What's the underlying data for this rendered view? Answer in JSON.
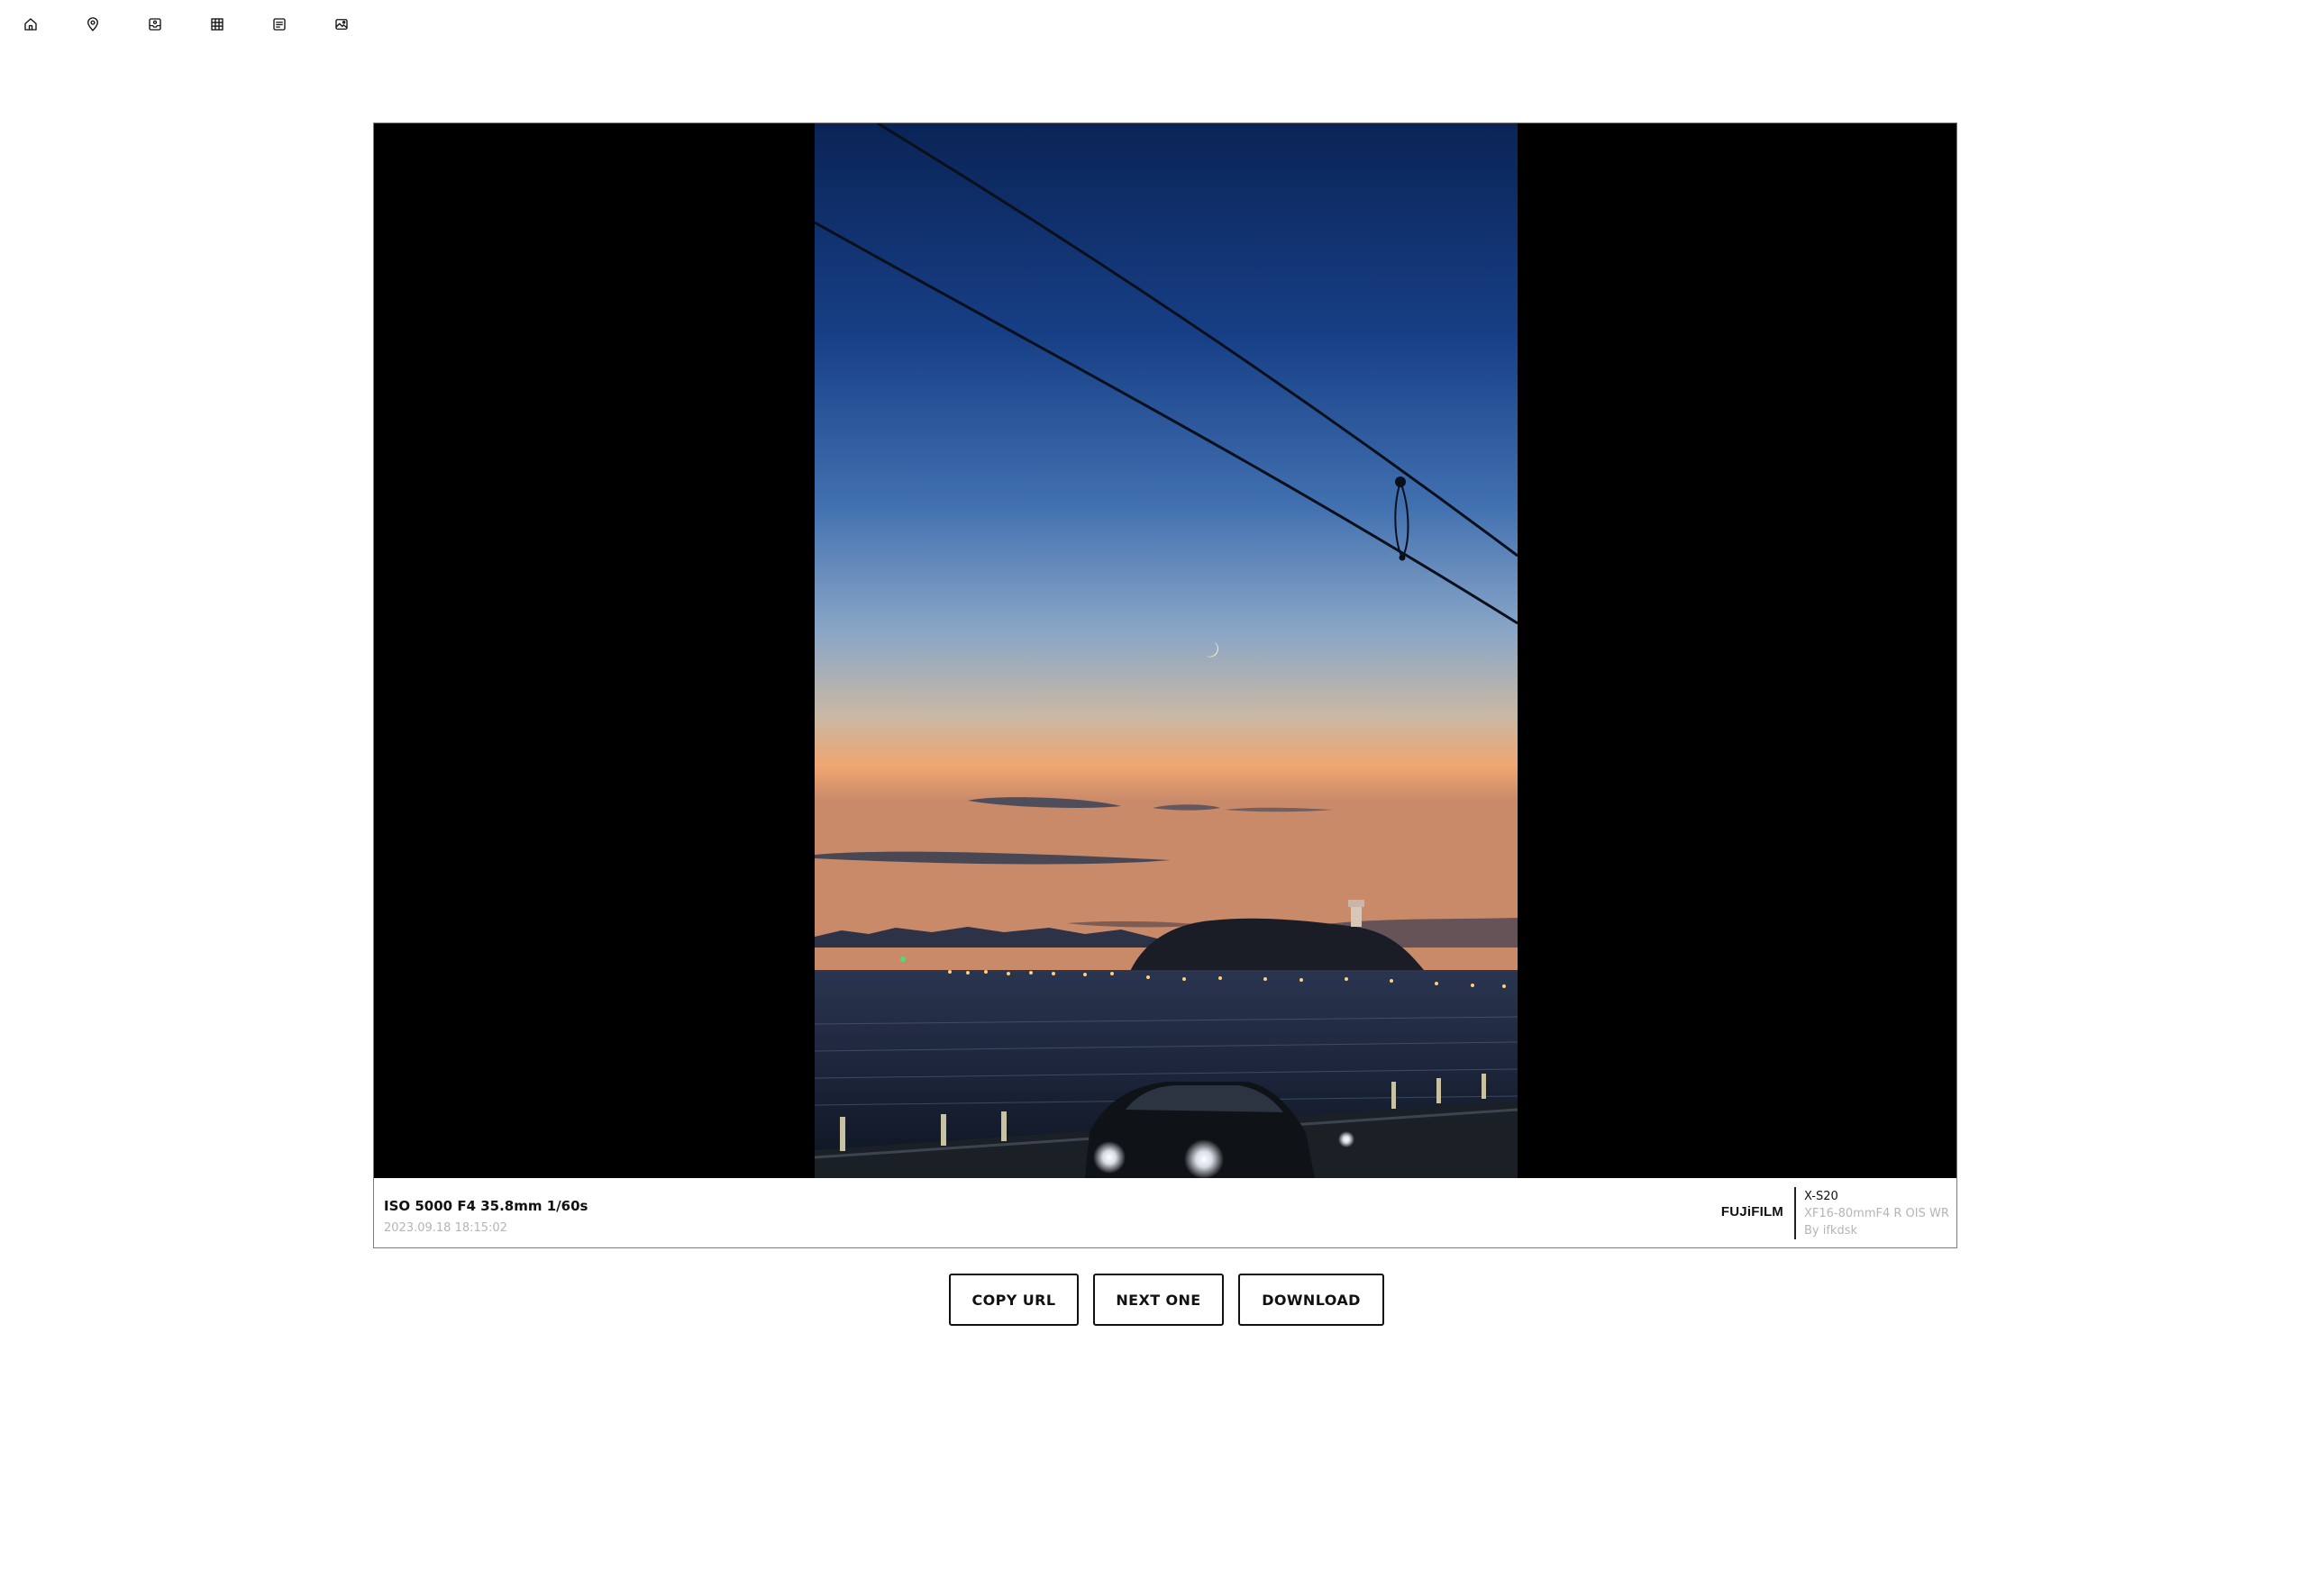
{
  "nav": {
    "items": [
      {
        "icon": "home-icon",
        "label": "Home"
      },
      {
        "icon": "map-pin-icon",
        "label": "Map"
      },
      {
        "icon": "inbox-icon",
        "label": "Inbox"
      },
      {
        "icon": "grid-icon",
        "label": "Grid"
      },
      {
        "icon": "list-icon",
        "label": "List"
      },
      {
        "icon": "image-icon",
        "label": "Photo"
      }
    ]
  },
  "photo": {
    "subject": "Twilight over Enoshima with crescent moon and power lines",
    "background_color": "#000000"
  },
  "exif": {
    "settings": "ISO 5000 F4 35.8mm 1/60s",
    "datetime": "2023.09.18 18:15:02",
    "brand": "FUJiFILM",
    "camera": "X-S20",
    "lens": "XF16-80mmF4 R OIS WR",
    "author": "By ifkdsk"
  },
  "actions": {
    "copy_url": "COPY URL",
    "next_one": "NEXT ONE",
    "download": "DOWNLOAD"
  },
  "colors": {
    "text": "#111111",
    "muted": "#b5b5b5",
    "border": "#7a7a7a"
  }
}
